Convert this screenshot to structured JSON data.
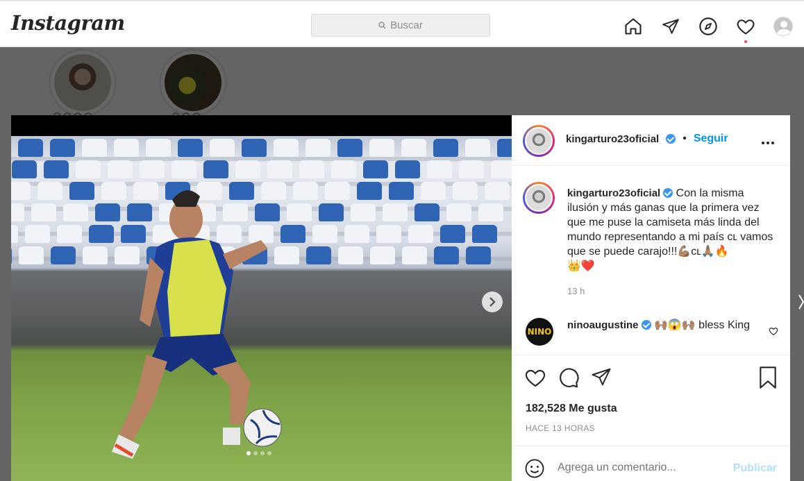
{
  "header": {
    "logo": "Instagram",
    "search_placeholder": "Buscar",
    "icons": [
      "home-icon",
      "direct-icon",
      "explore-icon",
      "activity-heart-icon",
      "profile-avatar"
    ]
  },
  "post": {
    "author": "kingarturo23oficial",
    "verified": true,
    "separator": "•",
    "follow_label": "Seguir",
    "more_label": "•••",
    "caption": "Con la misma ilusión y más ganas que la primera vez que me puse la camiseta más linda del mundo representando a mi país ᴄʟ vamos que se puede carajo!!!💪🏽ᴄʟ🙏🏽🔥",
    "caption_line2": "👑❤️",
    "caption_time": "13 h",
    "comment": {
      "author": "ninoaugustine",
      "avatar_text": "NINO",
      "text": "🙌🏽😱🙌🏽 bless King"
    },
    "likes": "182,528 Me gusta",
    "posted_ago": "HACE 13 HORAS",
    "comment_placeholder": "Agrega un comentario...",
    "publish_label": "Publicar",
    "carousel": {
      "total": 4,
      "current": 1
    }
  },
  "colors": {
    "accent": "#0095f6",
    "publish_disabled": "#b2dffc",
    "verified": "#3897f0",
    "notification_dot": "#ed4956"
  }
}
